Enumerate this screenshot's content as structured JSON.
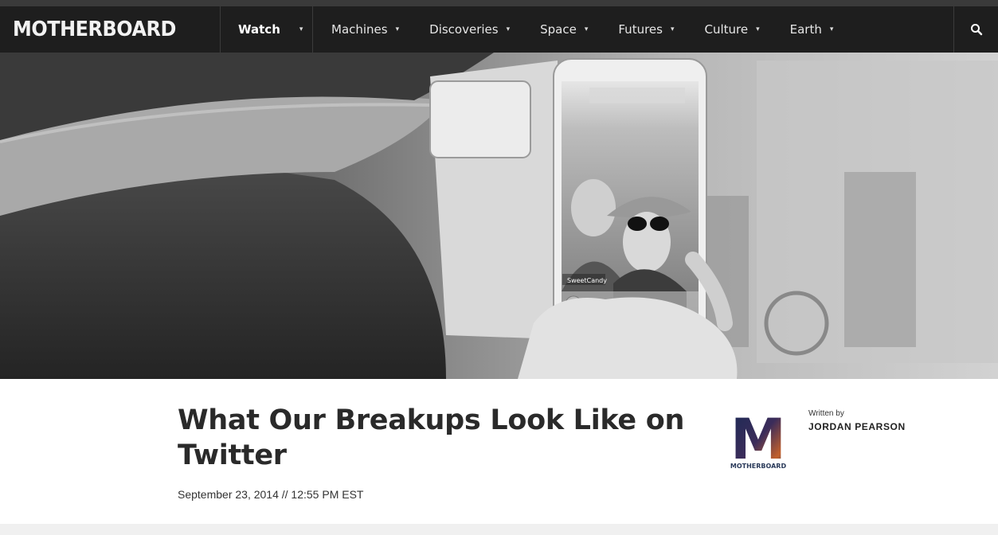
{
  "site": {
    "logo_text": "MOTHERBOARD"
  },
  "nav": {
    "active": {
      "label": "Watch"
    },
    "items": [
      {
        "label": "Machines"
      },
      {
        "label": "Discoveries"
      },
      {
        "label": "Space"
      },
      {
        "label": "Futures"
      },
      {
        "label": "Culture"
      },
      {
        "label": "Earth"
      }
    ],
    "caret_glyph": "▾",
    "search_icon": "search-icon"
  },
  "hero": {
    "phone_app_label": "SweetCandy"
  },
  "article": {
    "headline": "What Our Breakups Look Like on Twitter",
    "dateline": "September 23, 2014 // 12:55 PM EST",
    "byline_label": "Written by",
    "author": "JORDAN PEARSON",
    "avatar_letter": "M",
    "avatar_caption": "MOTHERBOARD"
  },
  "colors": {
    "navbar_bg": "#1e1e1e",
    "text_dark": "#2a2a2a"
  }
}
